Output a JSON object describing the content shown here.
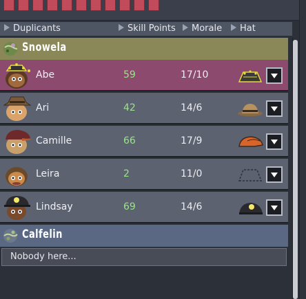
{
  "header": {
    "columns": [
      {
        "label": "Duplicants"
      },
      {
        "label": "Skill Points"
      },
      {
        "label": "Morale"
      },
      {
        "label": "Hat"
      }
    ]
  },
  "top_slots_count": 11,
  "colors": {
    "group_snowela": "#8a8759",
    "group_calfelin": "#5a6883",
    "row_selected": "#8c4a6e",
    "row_normal": "#5d6270",
    "skill_green": "#9be38a",
    "slot_red": "#c24b5b"
  },
  "groups": [
    {
      "name": "Snowela",
      "icon": "planet-icon",
      "rows": [
        {
          "name": "Abe",
          "skill_points": "59",
          "morale": "17/10",
          "hat_icon": "fancy-hat-icon",
          "selected": true
        },
        {
          "name": "Ari",
          "skill_points": "42",
          "morale": "14/6",
          "hat_icon": "safari-hat-icon",
          "selected": false
        },
        {
          "name": "Camille",
          "skill_points": "66",
          "morale": "17/9",
          "hat_icon": "cap-hat-icon",
          "selected": false
        },
        {
          "name": "Leira",
          "skill_points": "2",
          "morale": "11/0",
          "hat_icon": "empty-hat-icon",
          "selected": false
        },
        {
          "name": "Lindsay",
          "skill_points": "69",
          "morale": "14/6",
          "hat_icon": "mining-helmet-icon",
          "selected": false
        }
      ]
    },
    {
      "name": "Calfelin",
      "icon": "planet-icon",
      "empty_text": "Nobody here..."
    }
  ]
}
